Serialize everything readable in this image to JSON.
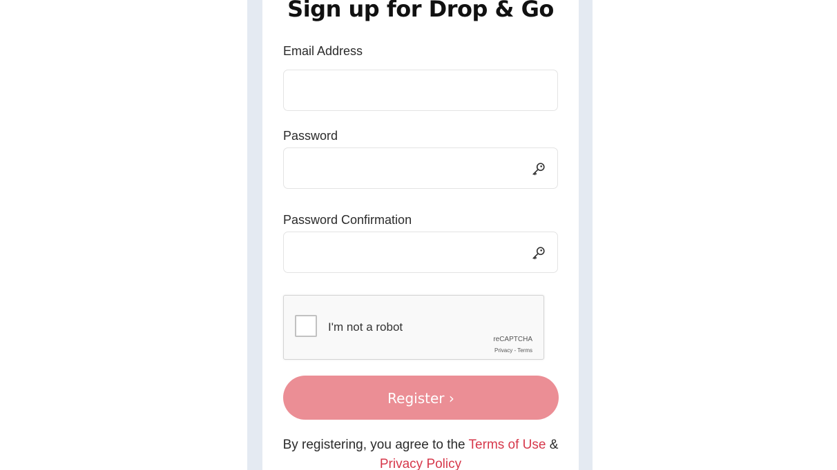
{
  "form": {
    "title": "Sign up for Drop & Go",
    "email": {
      "label": "Email Address",
      "value": ""
    },
    "password": {
      "label": "Password",
      "value": "",
      "icon": "key-icon"
    },
    "password_confirmation": {
      "label": "Password Confirmation",
      "value": "",
      "icon": "key-icon"
    },
    "captcha": {
      "label": "I'm not a robot",
      "brand": "reCAPTCHA",
      "privacy": "Privacy",
      "separator": " - ",
      "terms": "Terms"
    },
    "register_button": "Register ›",
    "agreement": {
      "prefix": "By registering, you agree to the ",
      "terms_link": "Terms of Use",
      "connector": " &",
      "privacy_link": "Privacy Policy"
    }
  },
  "colors": {
    "accent": "#eb8e95",
    "link": "#d6374a",
    "frame": "#e4eaf2"
  }
}
